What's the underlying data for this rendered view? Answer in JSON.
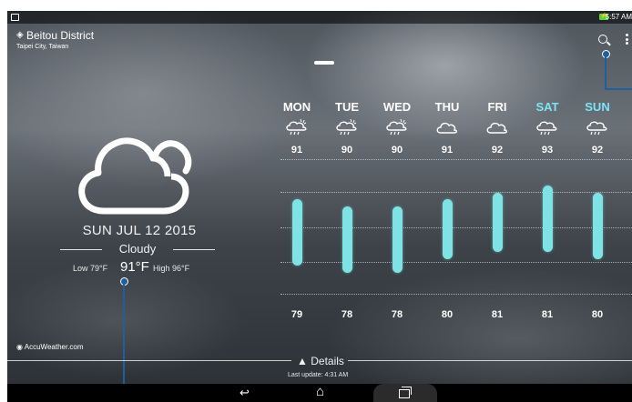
{
  "status_bar": {
    "time": "5:57 AM"
  },
  "location": {
    "name": "Beitou District",
    "region": "Taipei City, Taiwan"
  },
  "current": {
    "date": "SUN JUL 12 2015",
    "condition": "Cloudy",
    "low": "Low 79°F",
    "temp": "91°F",
    "high": "High 96°F",
    "icon": "cloudy-icon"
  },
  "forecast": [
    {
      "day": "MON",
      "high": "91",
      "low": "79",
      "icon": "thunderstorm-icon"
    },
    {
      "day": "TUE",
      "high": "90",
      "low": "78",
      "icon": "thunderstorm-icon"
    },
    {
      "day": "WED",
      "high": "90",
      "low": "78",
      "icon": "thunderstorm-icon"
    },
    {
      "day": "THU",
      "high": "91",
      "low": "80",
      "icon": "cloud-icon"
    },
    {
      "day": "FRI",
      "high": "92",
      "low": "81",
      "icon": "cloud-icon"
    },
    {
      "day": "SAT",
      "high": "93",
      "low": "81",
      "icon": "rain-icon"
    },
    {
      "day": "SUN",
      "high": "92",
      "low": "80",
      "icon": "rain-icon"
    }
  ],
  "forecast_range": {
    "min": 78,
    "max": 93
  },
  "weekend_color": "#7ee3f5",
  "bar_color": "#7fe3e6",
  "callout_color": "#1f5f9e",
  "branding": "AccuWeather.com",
  "footer": {
    "details_label": "Details",
    "last_update": "Last update: 4:31 AM"
  }
}
